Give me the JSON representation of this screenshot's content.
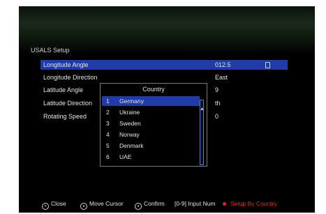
{
  "menu": {
    "title": "USALS Setup"
  },
  "settings": [
    {
      "label": "Longitude Angle",
      "value": "012.5"
    },
    {
      "label": "Longitude Direction",
      "value": "East"
    },
    {
      "label": "Latitude Angle",
      "value": "9"
    },
    {
      "label": "Latitude Direction",
      "value": "th"
    },
    {
      "label": "Rotating Speed",
      "value": "0"
    }
  ],
  "popup": {
    "title": "Country",
    "items": [
      {
        "num": "1",
        "name": "Germany"
      },
      {
        "num": "2",
        "name": "Ukraine"
      },
      {
        "num": "3",
        "name": "Sweden"
      },
      {
        "num": "4",
        "name": "Norway"
      },
      {
        "num": "5",
        "name": "Denmark"
      },
      {
        "num": "6",
        "name": "UAE"
      }
    ]
  },
  "footer": {
    "close_label": "Close",
    "move_label": "Move Cursor",
    "confirm_label": "Confirm",
    "input_label": "[0-9] Input Num",
    "setup_label": "Setup By Country"
  },
  "colors": {
    "highlight": "#1f3ca8",
    "red_button": "#e32222",
    "background": "#000000"
  },
  "icons": {
    "satellite": "satellite-icon",
    "scroll": "scroll-indicator-icon"
  }
}
